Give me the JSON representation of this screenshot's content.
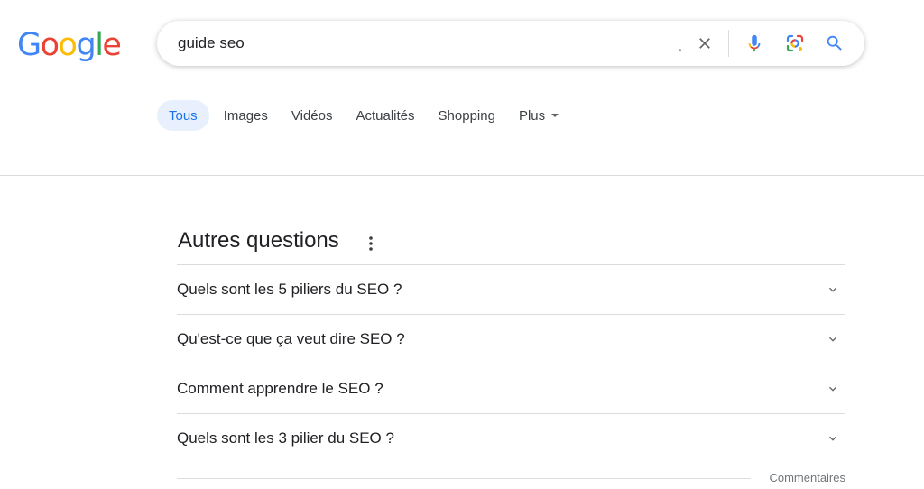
{
  "logo": {
    "letters": [
      {
        "char": "G",
        "color": "#4285F4"
      },
      {
        "char": "o",
        "color": "#EA4335"
      },
      {
        "char": "o",
        "color": "#FBBC05"
      },
      {
        "char": "g",
        "color": "#4285F4"
      },
      {
        "char": "l",
        "color": "#34A853"
      },
      {
        "char": "e",
        "color": "#EA4335"
      }
    ]
  },
  "search": {
    "value": "guide seo",
    "trailing_mark": ".",
    "icons": {
      "clear": "close-icon",
      "voice": "microphone-icon",
      "lens": "google-lens-icon",
      "submit": "search-icon"
    }
  },
  "tabs": [
    {
      "label": "Tous",
      "active": true
    },
    {
      "label": "Images"
    },
    {
      "label": "Vidéos"
    },
    {
      "label": "Actualités"
    },
    {
      "label": "Shopping"
    },
    {
      "label": "Plus"
    }
  ],
  "colors": {
    "accent": "#1a73e8",
    "active_tab_bg": "#e8f0fe",
    "divider": "#dadce0"
  },
  "paa": {
    "title": "Autres questions",
    "questions": [
      "Quels sont les 5 piliers du SEO ?",
      "Qu'est-ce que ça veut dire SEO ?",
      "Comment apprendre le SEO ?",
      "Quels sont les 3 pilier du SEO ?"
    ],
    "feedback": "Commentaires"
  }
}
